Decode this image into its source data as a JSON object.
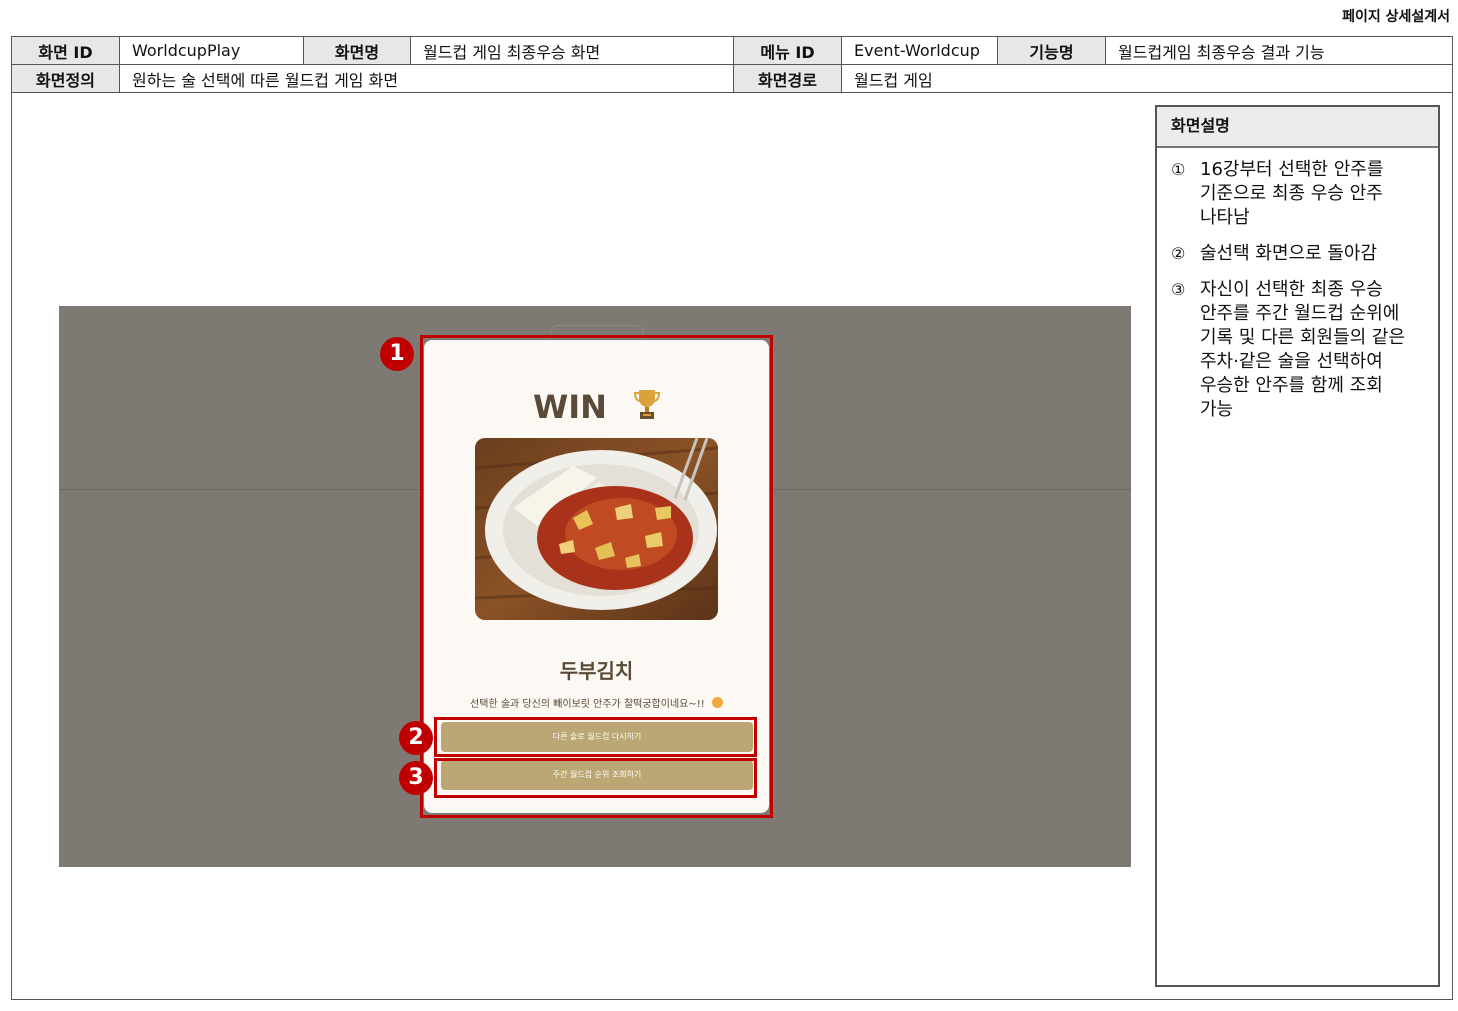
{
  "doc_title": "페이지 상세설계서",
  "meta": {
    "screen_id_label": "화면 ID",
    "screen_id": "WorldcupPlay",
    "screen_name_label": "화면명",
    "screen_name": "월드컵 게임 최종우승 화면",
    "menu_id_label": "메뉴 ID",
    "menu_id": "Event-Worldcup",
    "feature_label": "기능명",
    "feature": "월드컵게임 최종우승 결과 기능",
    "definition_label": "화면정의",
    "definition": "원하는 술 선택에 따른 월드컵 게임 화면",
    "path_label": "화면경로",
    "path": "월드컵 게임"
  },
  "mockup": {
    "win_text": "WIN",
    "food_name": "두부김치",
    "description": "선택한 술과 당신의 빼이보릿 안주가 찰떡궁합이네요~!!",
    "btn_retry": "다른 술로 월드컵 다시하기",
    "btn_ranking": "주간 월드컵 순위 조회하기"
  },
  "badges": [
    "1",
    "2",
    "3"
  ],
  "panel": {
    "title": "화면설명",
    "items": [
      {
        "num": "①",
        "text": "16강부터 선택한 안주를\n기준으로 최종 우승 안주\n나타남"
      },
      {
        "num": "②",
        "text": "술선택 화면으로 돌아감"
      },
      {
        "num": "③",
        "text": "자신이 선택한 최종 우승\n안주를 주간 월드컵 순위에\n기록 및 다른 회원들의 같은\n주차·같은 술을 선택하여\n우승한 안주를 함께 조회\n가능"
      }
    ]
  },
  "colors": {
    "highlight": "#c00000",
    "button": "#bba774",
    "overlay": "#7e7a73",
    "text_brown": "#5a4a38"
  },
  "icons": [
    "trophy-icon",
    "smile-emoji-icon"
  ]
}
